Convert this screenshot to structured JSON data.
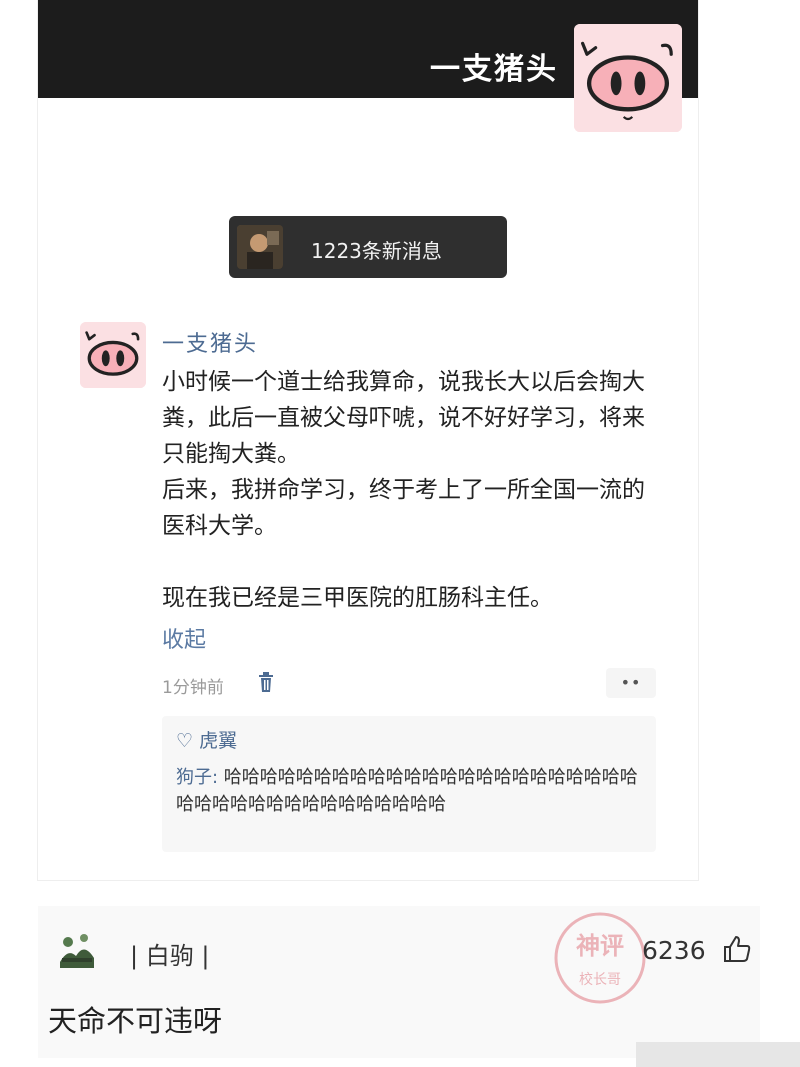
{
  "header": {
    "title": "一支猪头"
  },
  "notification": {
    "text": "1223条新消息"
  },
  "post": {
    "author": "一支猪头",
    "paragraphs": [
      "小时候一个道士给我算命，说我长大以后会掏大粪，此后一直被父母吓唬，说不好好学习，将来只能掏大粪。",
      "后来，我拼命学习，终于考上了一所全国一流的医科大学。",
      "现在我已经是三甲医院的肛肠科主任。"
    ],
    "collapse_label": "收起",
    "time": "1分钟前",
    "more": "••",
    "reply": {
      "liked_by": "♡ 虎翼",
      "author": "狗子:",
      "text": " 哈哈哈哈哈哈哈哈哈哈哈哈哈哈哈哈哈哈哈哈哈哈哈哈哈哈哈哈哈哈哈哈哈哈哈哈哈哈"
    }
  },
  "comment": {
    "name": "| 白驹 |",
    "likes": "6236",
    "text": "天命不可违呀",
    "stamp_text": [
      "神评",
      "校长哥"
    ]
  },
  "colors": {
    "header_bg": "#1c1c1c",
    "link_blue": "#4d6b92",
    "pig_pink": "#fbe0e3"
  },
  "icons": [
    "pig-avatar-icon",
    "trash-icon",
    "heart-icon",
    "thumbs-up-icon"
  ]
}
